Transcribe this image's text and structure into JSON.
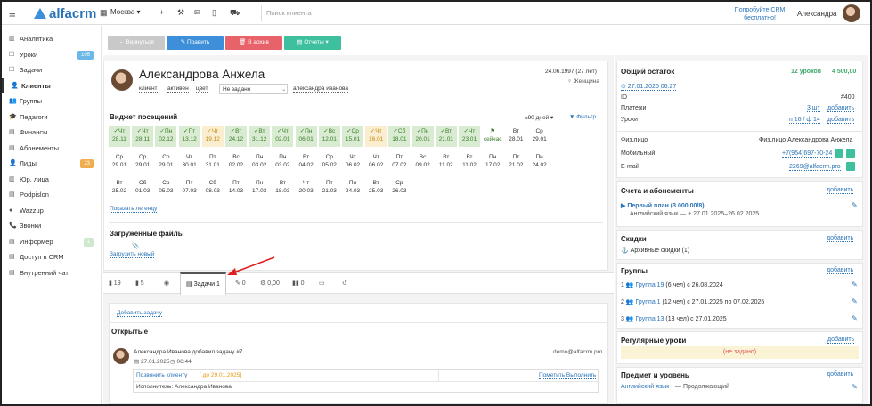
{
  "topbar": {
    "logo": "alfacrm",
    "city": "Москва ▾",
    "search_placeholder": "Поиск клиента",
    "promo": "Попробуйте CRM бесплатно!",
    "user": "Александра"
  },
  "sidebar": {
    "items": [
      {
        "label": "Аналитика",
        "icon": "▥"
      },
      {
        "label": "Уроки",
        "icon": "☐",
        "badge": "105"
      },
      {
        "label": "Задачи",
        "icon": "☐"
      },
      {
        "label": "Клиенты",
        "icon": "👤"
      },
      {
        "label": "Группы",
        "icon": "👥"
      },
      {
        "label": "Педагоги",
        "icon": "🎓"
      },
      {
        "label": "Финансы",
        "icon": "▤"
      },
      {
        "label": "Абонементы",
        "icon": "▤"
      },
      {
        "label": "Лиды",
        "icon": "👤",
        "badge": "23"
      },
      {
        "label": "Юр. лица",
        "icon": "▥"
      },
      {
        "label": "Podpislon",
        "icon": "▤"
      },
      {
        "label": "Wazzup",
        "icon": "●"
      },
      {
        "label": "Звонки",
        "icon": "📞"
      },
      {
        "label": "Информер",
        "icon": "▤",
        "badge": "1"
      },
      {
        "label": "Доступ в CRM",
        "icon": "▤"
      },
      {
        "label": "Внутренний чат",
        "icon": "▤"
      }
    ]
  },
  "actions": {
    "back": "← Вернуться",
    "edit": "✎ Править",
    "archive": "🗑 В архив",
    "reports": "▤ Отчеты ▾"
  },
  "client": {
    "name": "Александрова Анжела",
    "birth": "24.06.1997 (27 лет)",
    "gender": "♀ Женщина",
    "tags": [
      "клиент",
      "активен",
      "цвет"
    ],
    "status_select": "Не задано",
    "manager": "александра иванова"
  },
  "visits": {
    "title": "Виджет посещений",
    "period": "±90 дней ▾",
    "filter": "▼ Фильтр",
    "legend_link": "Показать легенду",
    "rows": [
      [
        [
          "✓Чт",
          "28.11",
          "g"
        ],
        [
          "✓Чт",
          "28.11",
          "g"
        ],
        [
          "✓Пн",
          "02.12",
          "g"
        ],
        [
          "✓Пт",
          "13.12",
          "g"
        ],
        [
          "✓Чт",
          "19.12",
          "o"
        ],
        [
          "✓Вт",
          "24.12",
          "g"
        ],
        [
          "✓Вт",
          "31.12",
          "g"
        ],
        [
          "✓Чт",
          "02.01",
          "g"
        ],
        [
          "✓Пн",
          "06.01",
          "g"
        ],
        [
          "✓Вс",
          "12.01",
          "g"
        ],
        [
          "✓Ср",
          "15.01",
          "g"
        ],
        [
          "✓Чт",
          "16.01",
          "o"
        ],
        [
          "✓Сб",
          "18.01",
          "g"
        ],
        [
          "✓Пн",
          "20.01",
          "g"
        ],
        [
          "✓Вт",
          "21.01",
          "g"
        ],
        [
          "✓Чт",
          "23.01",
          "g"
        ],
        [
          "⚑",
          "сейчас",
          "now"
        ],
        [
          "Вт",
          "28.01",
          ""
        ],
        [
          "Ср",
          "29.01",
          ""
        ]
      ],
      [
        [
          "Ср",
          "29.01",
          ""
        ],
        [
          "Ср",
          "29.01",
          ""
        ],
        [
          "Ср",
          "29.01",
          ""
        ],
        [
          "Чт",
          "30.01",
          ""
        ],
        [
          "Пт",
          "31.01",
          ""
        ],
        [
          "Вс",
          "02.02",
          ""
        ],
        [
          "Пн",
          "03.02",
          ""
        ],
        [
          "Пн",
          "03.02",
          ""
        ],
        [
          "Вт",
          "04.02",
          ""
        ],
        [
          "Ср",
          "05.02",
          ""
        ],
        [
          "Чт",
          "06.02",
          ""
        ],
        [
          "Чт",
          "06.02",
          ""
        ],
        [
          "Пт",
          "07.02",
          ""
        ],
        [
          "Вс",
          "09.02",
          ""
        ],
        [
          "Вт",
          "11.02",
          ""
        ],
        [
          "Вт",
          "11.02",
          ""
        ],
        [
          "Пн",
          "17.02",
          ""
        ],
        [
          "Пт",
          "21.02",
          ""
        ],
        [
          "Пн",
          "24.02",
          ""
        ]
      ],
      [
        [
          "Вт",
          "25.02",
          ""
        ],
        [
          "Сб",
          "01.03",
          ""
        ],
        [
          "Ср",
          "05.03",
          ""
        ],
        [
          "Пт",
          "07.03",
          ""
        ],
        [
          "Сб",
          "08.03",
          ""
        ],
        [
          "Пт",
          "14.03",
          ""
        ],
        [
          "Пн",
          "17.03",
          ""
        ],
        [
          "Вт",
          "18.03",
          ""
        ],
        [
          "Чт",
          "20.03",
          ""
        ],
        [
          "Пт",
          "21.03",
          ""
        ],
        [
          "Пн",
          "24.03",
          ""
        ],
        [
          "Вт",
          "25.03",
          ""
        ],
        [
          "Ср",
          "26.03",
          ""
        ]
      ]
    ]
  },
  "files": {
    "title": "Загруженные файлы",
    "upload": "Загрузить новый"
  },
  "tabs": [
    {
      "label": "▮ 19"
    },
    {
      "label": "▮ 5"
    },
    {
      "label": "◉"
    },
    {
      "label": "▤ Задачи 1"
    },
    {
      "label": "✎ 0"
    },
    {
      "label": "⚙ 0,00"
    },
    {
      "label": "▮▮ 0"
    },
    {
      "label": "▭"
    },
    {
      "label": "↺"
    }
  ],
  "tasks": {
    "add": "Добавить задачу",
    "open_title": "Открытые",
    "author_line": "Александра Иванова добавил задачу #7",
    "email": "demo@alfacrm.pro",
    "date": "▤ 27.01.2025",
    "time": "◷ 06:44",
    "task": "Позвонить клиенту",
    "deadline": "[ до 29.01.2025]",
    "done": "Пометить Выполнить",
    "executor": "Исполнитель: Александра Иванова"
  },
  "right": {
    "balance_title": "Общий остаток",
    "balance_lessons": "12 уроков",
    "balance_sum": "4 500,00",
    "balance_date": "⊙ 27.01.2025 06:27",
    "id_label": "ID",
    "id_value": "#400",
    "payments_label": "Платежи",
    "payments_value": "3 шт",
    "add": "добавить",
    "lessons_label": "Уроки",
    "lessons_value": "п 16 / ф 14",
    "person_label": "Физ.лицо",
    "person_value": "Физ.лицо Александрова Анжела",
    "mobile_label": "Мобильный",
    "mobile_value": "+7(954)697-70-24",
    "email_label": "E-mail",
    "email_value": "2269@alfacrm.pro",
    "subs_title": "Счета и абонементы",
    "plan": "▶ Первый план (3 000,00/8)",
    "plan_sub": "Английский язык — + 27.01.2025–26.02.2025",
    "disc_title": "Скидки",
    "disc_archive": "⚓ Архивные скидки (1)",
    "groups_title": "Группы",
    "groups": [
      {
        "n": "1",
        "name": "Группа 19",
        "info": " (6 чел) с 26.08.2024"
      },
      {
        "n": "2",
        "name": "Группа 1",
        "info": " (12 чел) с 27.01.2025 по 07.02.2025"
      },
      {
        "n": "3",
        "name": "Группа 13",
        "info": " (13 чел) с 27.01.2025"
      }
    ],
    "reg_title": "Регулярные уроки",
    "reg_value": "(не задано)",
    "subj_title": "Предмет и уровень",
    "subj_name": "Английский язык",
    "subj_level": " — Продолжающий"
  }
}
